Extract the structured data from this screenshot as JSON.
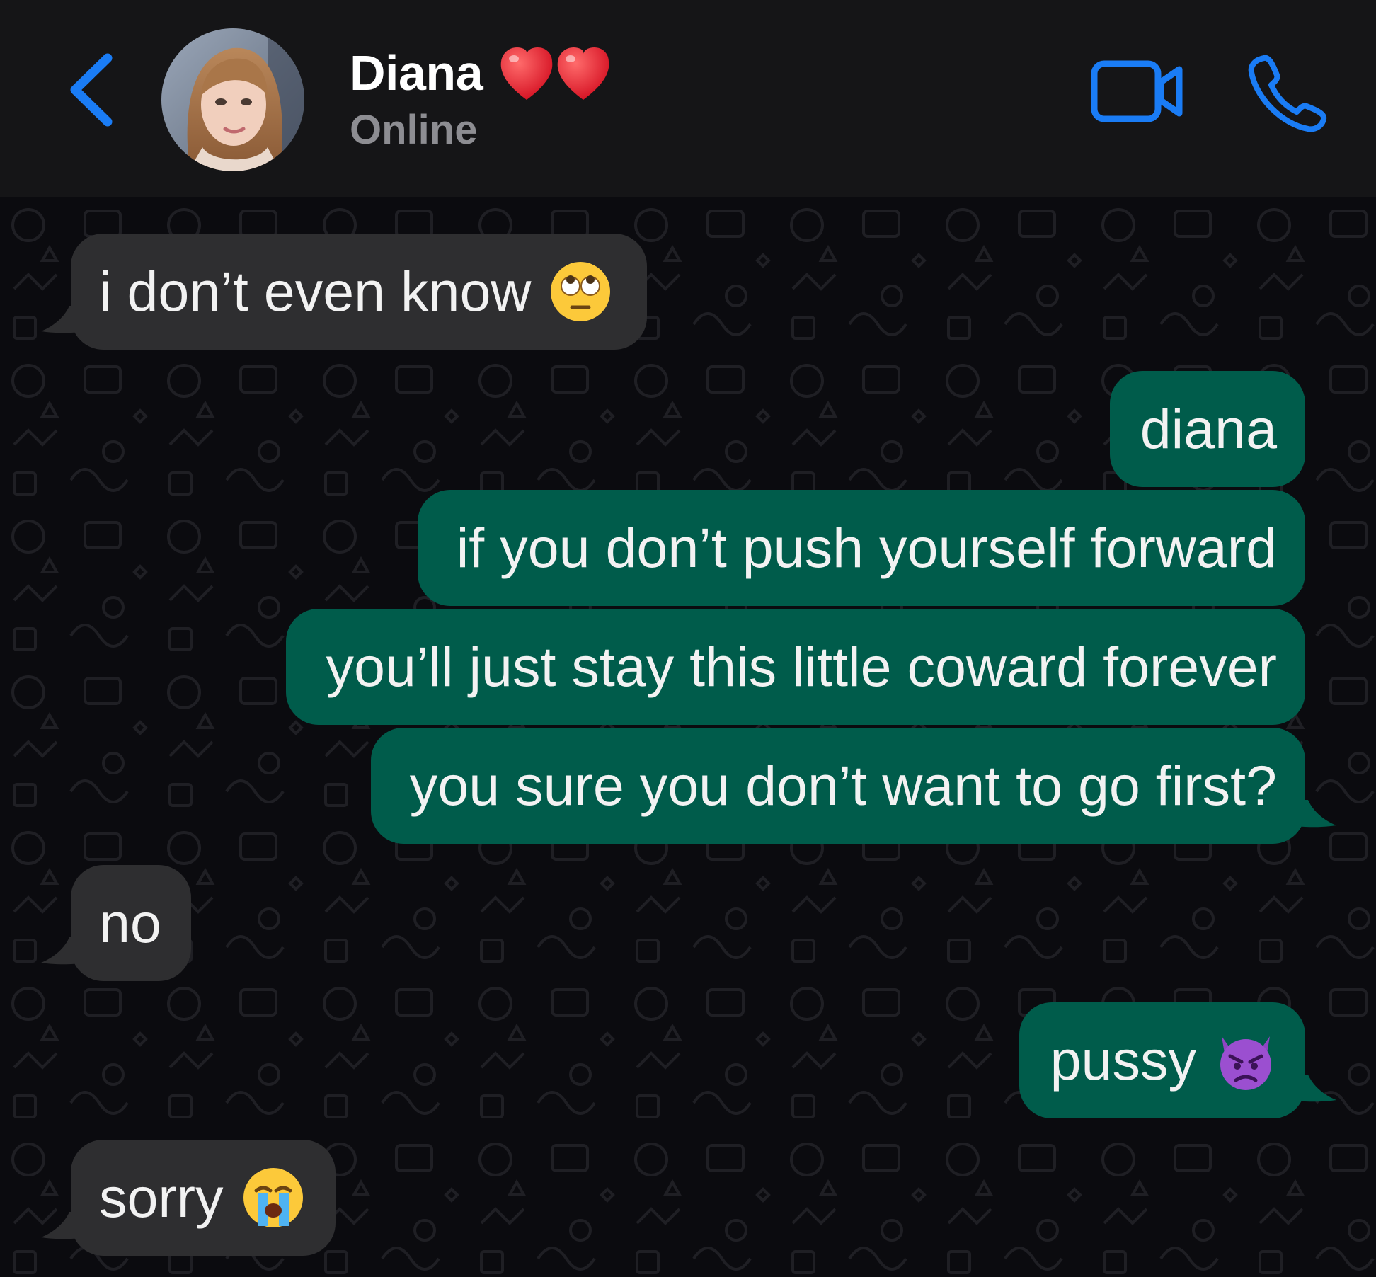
{
  "header": {
    "contact_name": "Diana",
    "name_emoji": "heart-red-icon",
    "status": "Online",
    "back_icon": "chevron-left-icon",
    "video_icon": "video-camera-icon",
    "call_icon": "phone-icon"
  },
  "messages": [
    {
      "direction": "incoming",
      "text": "i don’t even know",
      "emoji": "face-with-rolling-eyes-icon"
    },
    {
      "direction": "outgoing",
      "text": "diana"
    },
    {
      "direction": "outgoing",
      "text": "if you don’t push yourself forward"
    },
    {
      "direction": "outgoing",
      "text": "you’ll just stay this little coward forever"
    },
    {
      "direction": "outgoing",
      "text": "you sure you don’t want to go first?"
    },
    {
      "direction": "incoming",
      "text": "no"
    },
    {
      "direction": "outgoing",
      "text": "pussy",
      "emoji": "angry-devil-icon"
    },
    {
      "direction": "incoming",
      "text": "sorry",
      "emoji": "loudly-crying-face-icon"
    }
  ],
  "colors": {
    "header_bg": "#151517",
    "chat_bg": "#0b0b0f",
    "incoming_bubble": "#2e2e30",
    "outgoing_bubble": "#005c4b",
    "accent_blue": "#1a7cf5",
    "status_gray": "#8d8d92"
  }
}
